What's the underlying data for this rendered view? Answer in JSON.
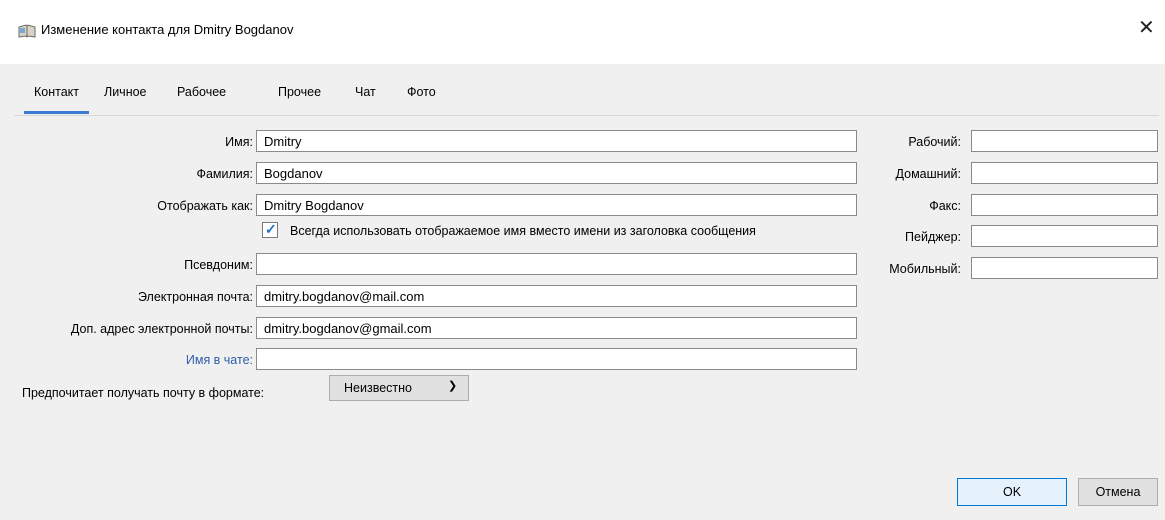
{
  "window": {
    "title": "Изменение контакта для Dmitry Bogdanov",
    "close_glyph": "✕",
    "icon": "address-book-icon"
  },
  "tabs": [
    {
      "label": "Контакт",
      "active": true
    },
    {
      "label": "Личное"
    },
    {
      "label": "Рабочее"
    },
    {
      "label": "Прочее"
    },
    {
      "label": "Чат"
    },
    {
      "label": "Фото"
    }
  ],
  "form": {
    "first_name": {
      "label": "Имя:",
      "value": "Dmitry"
    },
    "last_name": {
      "label": "Фамилия:",
      "value": "Bogdanov"
    },
    "display_name": {
      "label": "Отображать как:",
      "value": "Dmitry Bogdanov"
    },
    "always_use_display": {
      "label": "Всегда использовать отображаемое имя вместо имени из заголовка сообщения",
      "checked": true
    },
    "nickname": {
      "label": "Псевдоним:",
      "value": ""
    },
    "email": {
      "label": "Электронная почта:",
      "value": "dmitry.bogdanov@mail.com"
    },
    "alt_email": {
      "label": "Доп. адрес электронной почты:",
      "value": "dmitry.bogdanov@gmail.com"
    },
    "chat_name": {
      "label": "Имя в чате:",
      "value": ""
    },
    "mail_format": {
      "label": "Предпочитает получать почту в формате:",
      "value": "Неизвестно"
    }
  },
  "phones": {
    "work": {
      "label": "Рабочий:",
      "value": ""
    },
    "home": {
      "label": "Домашний:",
      "value": ""
    },
    "fax": {
      "label": "Факс:",
      "value": ""
    },
    "pager": {
      "label": "Пейджер:",
      "value": ""
    },
    "mobile": {
      "label": "Мобильный:",
      "value": ""
    }
  },
  "buttons": {
    "ok": "OK",
    "cancel": "Отмена"
  },
  "colors": {
    "accent": "#3a7bd5",
    "link_label": "#2f5ea8",
    "check": "#1f6fd1"
  }
}
